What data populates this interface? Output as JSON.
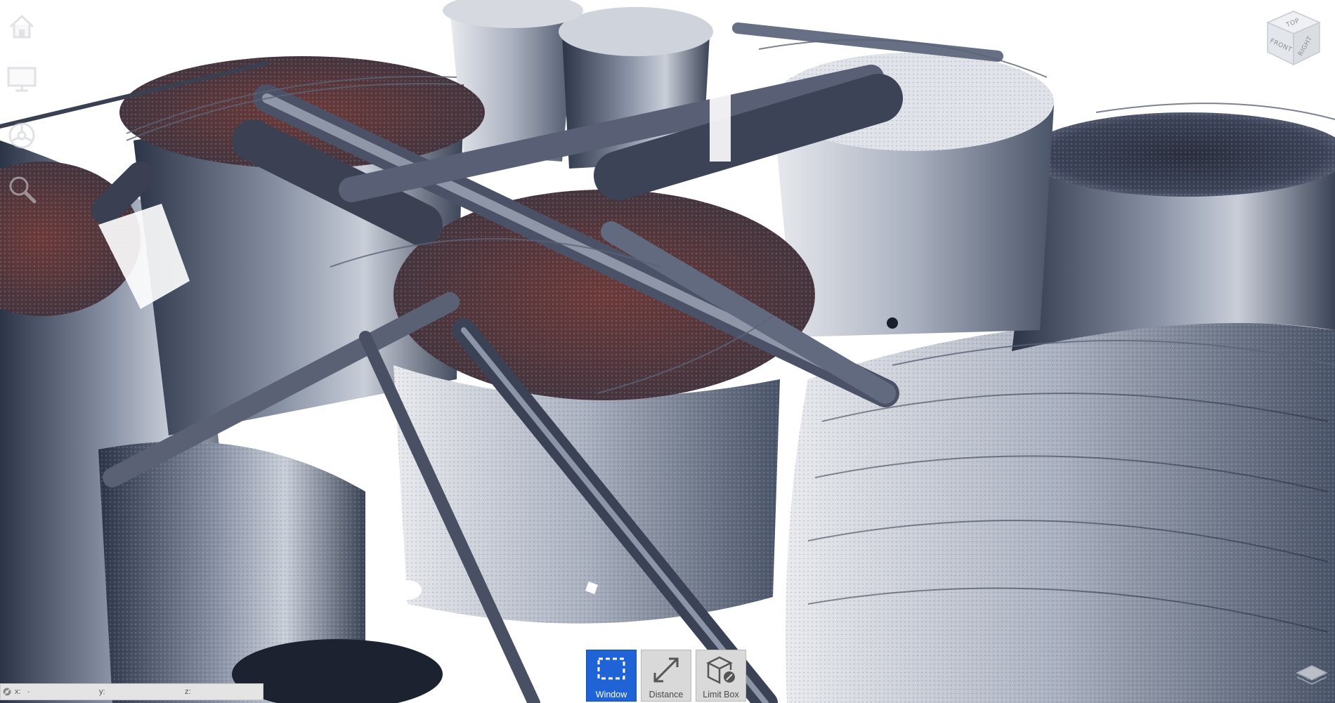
{
  "colors": {
    "accent": "#1f63d6",
    "toolbar_bg": "#d9d9d9",
    "tank_dark": "#3a4356",
    "tank_light": "#c9ced8",
    "rust": "#7a3f3a"
  },
  "nav_toolbar": {
    "items": [
      {
        "name": "home",
        "icon": "home-icon"
      },
      {
        "name": "fit-view",
        "icon": "monitor-icon"
      },
      {
        "name": "orbit",
        "icon": "steering-wheel-icon"
      },
      {
        "name": "zoom",
        "icon": "magnifier-icon"
      }
    ]
  },
  "view_cube": {
    "top": "TOP",
    "front": "FRONT",
    "right": "RIGHT"
  },
  "bottom_toolbar": {
    "tools": [
      {
        "label": "Window",
        "icon": "selection-window-icon",
        "active": true
      },
      {
        "label": "Distance",
        "icon": "measure-distance-icon",
        "active": false
      },
      {
        "label": "Limit Box",
        "icon": "limit-box-icon",
        "active": false
      }
    ]
  },
  "coordinates": {
    "x_label": "x:",
    "x_value": "-",
    "y_label": "y:",
    "y_value": "",
    "z_label": "z:",
    "z_value": ""
  }
}
